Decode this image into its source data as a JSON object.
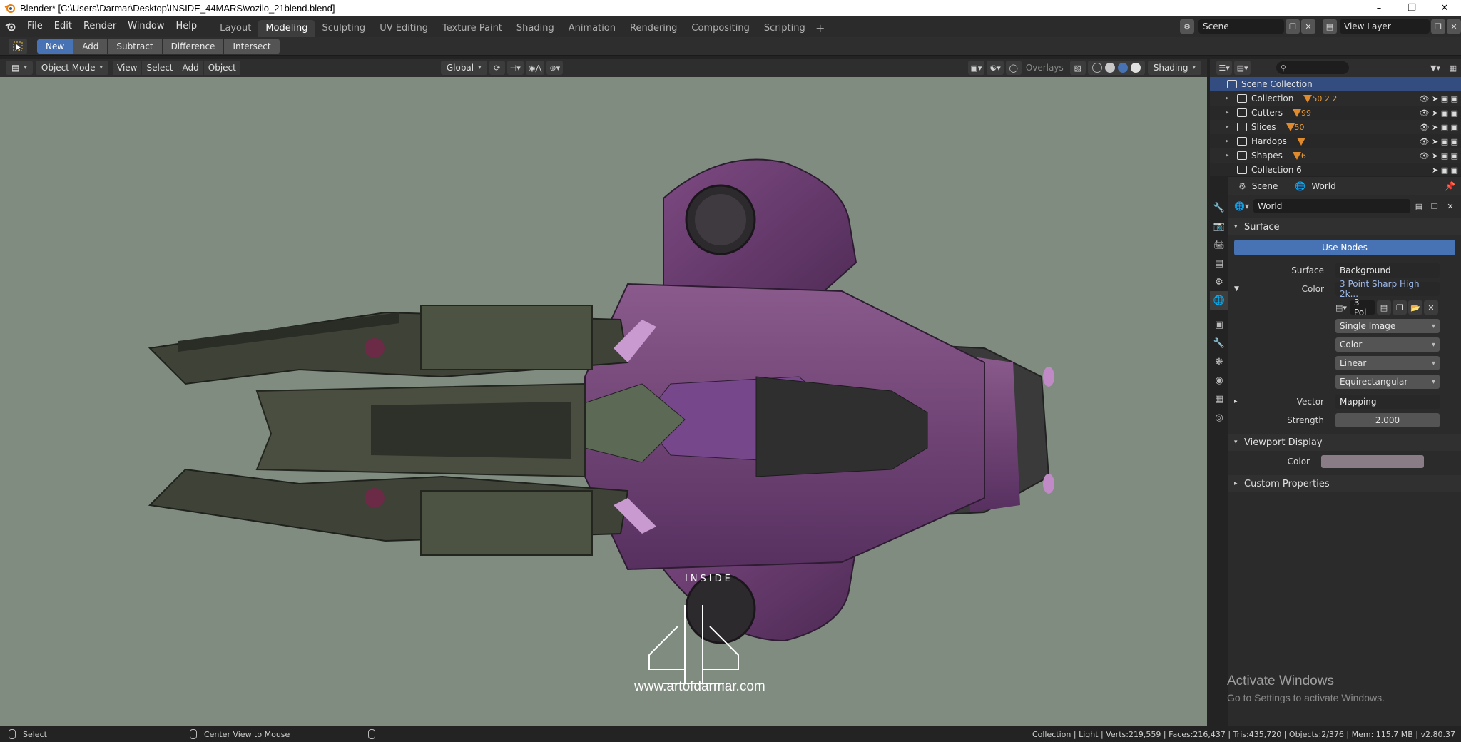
{
  "window": {
    "title": "Blender* [C:\\Users\\Darmar\\Desktop\\INSIDE_44MARS\\vozilo_21blend.blend]",
    "minimize": "–",
    "maximize": "❐",
    "close": "✕"
  },
  "menu": [
    "File",
    "Edit",
    "Render",
    "Window",
    "Help"
  ],
  "workspaces": [
    "Layout",
    "Modeling",
    "Sculpting",
    "UV Editing",
    "Texture Paint",
    "Shading",
    "Animation",
    "Rendering",
    "Compositing",
    "Scripting"
  ],
  "active_workspace": "Modeling",
  "scene_name": "Scene",
  "view_layer": "View Layer",
  "boolean_ops": [
    "New",
    "Add",
    "Subtract",
    "Difference",
    "Intersect"
  ],
  "viewport": {
    "mode": "Object Mode",
    "menus": [
      "View",
      "Select",
      "Add",
      "Object"
    ],
    "transform_orientation": "Global",
    "overlays_label": "Overlays",
    "shading_label": "Shading",
    "watermark_inside": "INSIDE",
    "watermark_url": "www.artofdarmar.com",
    "activate_title": "Activate Windows",
    "activate_sub": "Go to Settings to activate Windows."
  },
  "outliner": {
    "root": "Scene Collection",
    "items": [
      {
        "name": "Collection",
        "badge": "50 2 2"
      },
      {
        "name": "Cutters",
        "badge": "99"
      },
      {
        "name": "Slices",
        "badge": "50"
      },
      {
        "name": "Hardops",
        "badge": ""
      },
      {
        "name": "Shapes",
        "badge": "6"
      },
      {
        "name": "Collection 6",
        "badge": ""
      }
    ]
  },
  "properties": {
    "breadcrumb_scene": "Scene",
    "breadcrumb_world": "World",
    "world_name": "World",
    "surface_panel": "Surface",
    "use_nodes": "Use Nodes",
    "surface_label": "Surface",
    "surface_value": "Background",
    "color_label": "Color",
    "color_value": "3 Point Sharp High 2k...",
    "image_name": "3 Poi",
    "image_source": "Single Image",
    "color_space": "Color",
    "interpolation": "Linear",
    "projection": "Equirectangular",
    "vector_label": "Vector",
    "vector_value": "Mapping",
    "strength_label": "Strength",
    "strength_value": "2.000",
    "viewport_display_panel": "Viewport Display",
    "vd_color_label": "Color",
    "custom_props_panel": "Custom Properties"
  },
  "status": {
    "left1": "Select",
    "left2": "Center View to Mouse",
    "right": "Collection | Light | Verts:219,559 | Faces:216,437 | Tris:435,720 | Objects:2/376 | Mem: 115.7 MB | v2.80.37"
  },
  "colors": {
    "accent": "#4772b3",
    "viewport_bg": "#808c80",
    "ship_purple": "#6b3a6e",
    "ship_dark": "#3a3d36"
  }
}
